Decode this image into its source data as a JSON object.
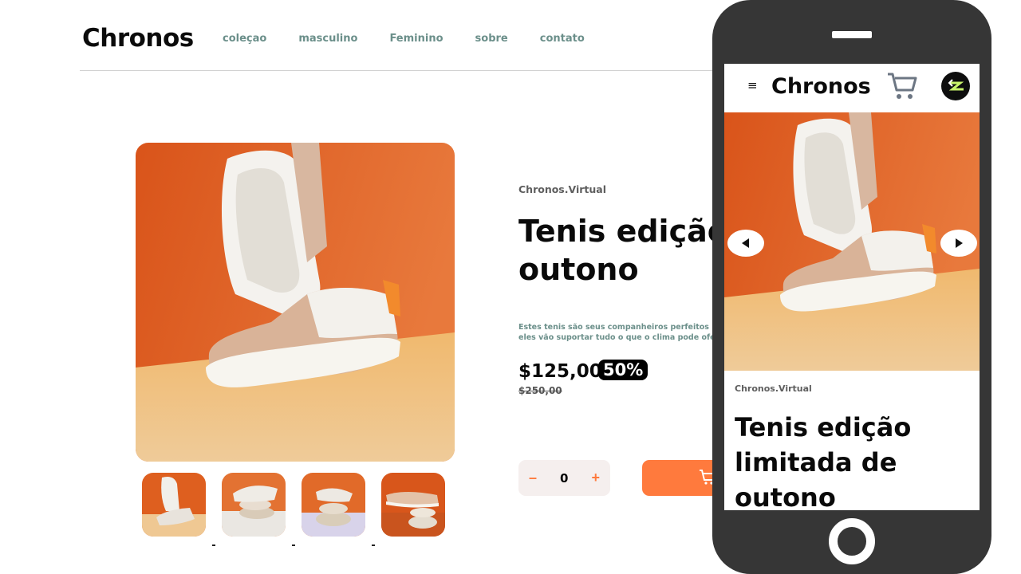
{
  "header": {
    "brand": "Chronos",
    "nav": [
      "coleçao",
      "masculino",
      "Feminino",
      "sobre",
      "contato"
    ]
  },
  "product": {
    "company": "Chronos.Virtual",
    "title_line1": "Tenis edição l",
    "title_line2": "outono",
    "description_line1": "Estes tenis são seus companheiros perfeitos para",
    "description_line2": "eles vão suportar tudo o que o clima pode oferec",
    "price": "$125,00",
    "discount": "50%",
    "old_price": "$250,00",
    "quantity": "0",
    "minus": "–",
    "plus": "+"
  },
  "mobile": {
    "menu_icon": "≡",
    "brand": "Chronos",
    "company": "Chronos.Virtual",
    "title": "Tenis edição limitada de outono"
  },
  "colors": {
    "accent": "#ff7a3d",
    "nav_text": "#6b8f8a",
    "phone_body": "#363636",
    "hero_orange": "#e4651e",
    "hero_floor": "#f0c78f"
  },
  "icons": [
    "cart-icon",
    "avatar-icon",
    "arrow-left-icon",
    "arrow-right-icon",
    "menu-icon"
  ]
}
